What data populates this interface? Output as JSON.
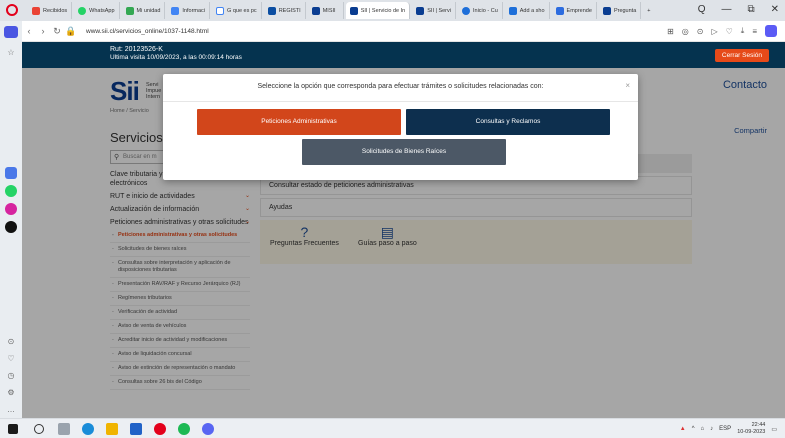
{
  "browser": {
    "tabs": [
      {
        "label": "Recibidos",
        "color": "#ea4335"
      },
      {
        "label": "WhatsApp",
        "color": "#25d366"
      },
      {
        "label": "Mi unidad",
        "color": "#34a853"
      },
      {
        "label": "Informaci",
        "color": "#4285f4"
      },
      {
        "label": "G que es pc",
        "color": "#4285f4"
      },
      {
        "label": "REGISTI",
        "color": "#0b4ea2"
      },
      {
        "label": "MISII",
        "color": "#0a3d91"
      },
      {
        "label": "SII | Servicio de In",
        "color": "#0a3d91"
      },
      {
        "label": "SII | Servi",
        "color": "#0a3d91"
      },
      {
        "label": "Inicio - Cu",
        "color": "#1e6fd9"
      },
      {
        "label": "Add a sho",
        "color": "#1e6fd9"
      },
      {
        "label": "Emprende",
        "color": "#2d6cdf"
      },
      {
        "label": "Pregunta",
        "color": "#0a3d91"
      }
    ],
    "url": "www.sii.cl/servicios_online/1037-1148.html",
    "window_controls": [
      "Q",
      "—",
      "⧉",
      "✕"
    ],
    "addr_icons": [
      "⊞",
      "◎",
      "⊙",
      "▷",
      "♡",
      "⤓",
      "≡"
    ]
  },
  "session": {
    "rut": "Rut: 20123526-K",
    "last_visit": "Ultima visita 10/09/2023, a las 00:09:14 horas",
    "logout_label": "Cerrar Sesión"
  },
  "header": {
    "logo_text": "Sii",
    "logo_sub": [
      "Servi",
      "Impue",
      "Intern"
    ],
    "contact": "Contacto",
    "breadcrumb": "Home / Servicio",
    "share": "Compartir",
    "page_title": "Servicios c"
  },
  "search": {
    "placeholder": "Buscar en m"
  },
  "leftnav": {
    "items": [
      {
        "label": "Clave tributaria y representantes electrónicos",
        "chev": "⌄"
      },
      {
        "label": "RUT e inicio de actividades",
        "chev": "⌄"
      },
      {
        "label": "Actualización de información",
        "chev": "⌄"
      },
      {
        "label": "Peticiones administrativas y otras solicitudes",
        "chev": "⌄"
      }
    ],
    "subitems": [
      "Peticiones administrativas y otras solicitudes",
      "Solicitudes de bienes raíces",
      "Consultas sobre interpretación y aplicación de disposiciones tributarias",
      "Presentación RAV/RAF y Recurso Jerárquico (RJ)",
      "Regímenes tributarios",
      "Verificación de actividad",
      "Aviso de venta de vehículos",
      "Acreditar inicio de actividad y modificaciones",
      "Aviso de liquidación concursal",
      "Aviso de extinción de representación o mandato",
      "Consultas sobre 26 bis del Código"
    ]
  },
  "content": {
    "rows": [
      "",
      "Consultar estado de peticiones administrativas",
      "Ayudas"
    ],
    "help": [
      {
        "icon": "?",
        "label": "Preguntas Frecuentes"
      },
      {
        "icon": "▤",
        "label": "Guías paso a paso"
      }
    ]
  },
  "modal": {
    "title": "Seleccione la opción que corresponda para efectuar trámites o solicitudes relacionadas con:",
    "close": "×",
    "buttons": {
      "peticiones": "Peticiones Administrativas",
      "consultas": "Consultas y Reclamos",
      "bienes": "Solicitudes de Bienes Raíces"
    }
  },
  "taskbar": {
    "lang": "ESP",
    "time": "22:44",
    "date": "10-09-2023"
  },
  "colors": {
    "sii_navy": "#05334f",
    "sii_orange": "#d2461b",
    "modal_navy": "#0d2f4e",
    "modal_gray": "#4c5866"
  }
}
